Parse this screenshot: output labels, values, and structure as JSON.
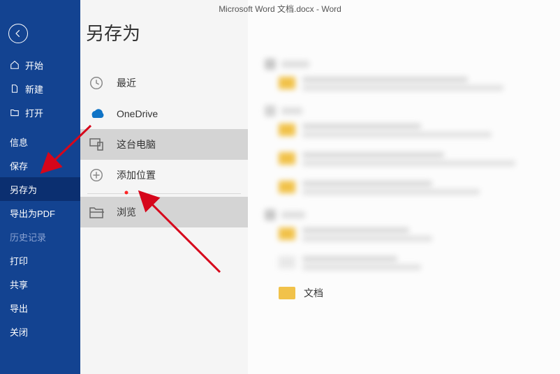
{
  "titlebar": {
    "filename": "Microsoft Word 文档.docx",
    "dash": "  -  ",
    "app": "Word"
  },
  "rail": {
    "back_tooltip": "Back",
    "items": [
      {
        "label": "开始",
        "icon": "home",
        "disabled": false
      },
      {
        "label": "新建",
        "icon": "new",
        "disabled": false
      },
      {
        "label": "打开",
        "icon": "open",
        "disabled": false
      },
      {
        "label": "信息",
        "icon": "",
        "disabled": false
      },
      {
        "label": "保存",
        "icon": "",
        "disabled": false
      },
      {
        "label": "另存为",
        "icon": "",
        "disabled": false,
        "selected": true
      },
      {
        "label": "导出为PDF",
        "icon": "",
        "disabled": false
      },
      {
        "label": "历史记录",
        "icon": "",
        "disabled": true
      },
      {
        "label": "打印",
        "icon": "",
        "disabled": false
      },
      {
        "label": "共享",
        "icon": "",
        "disabled": false
      },
      {
        "label": "导出",
        "icon": "",
        "disabled": false
      },
      {
        "label": "关闭",
        "icon": "",
        "disabled": false
      }
    ]
  },
  "mid": {
    "heading": "另存为",
    "options": [
      {
        "label": "最近",
        "icon": "recent",
        "selected": false
      },
      {
        "label": "OneDrive",
        "icon": "onedrive",
        "selected": false
      },
      {
        "label": "这台电脑",
        "icon": "thispc",
        "selected": true
      },
      {
        "label": "添加位置",
        "icon": "addplace",
        "selected": false
      }
    ],
    "browse": {
      "label": "浏览",
      "icon": "browse",
      "selected": true
    }
  },
  "right": {
    "docs_label": "文档"
  },
  "annotation": {
    "arrow_color": "#d6061b"
  }
}
